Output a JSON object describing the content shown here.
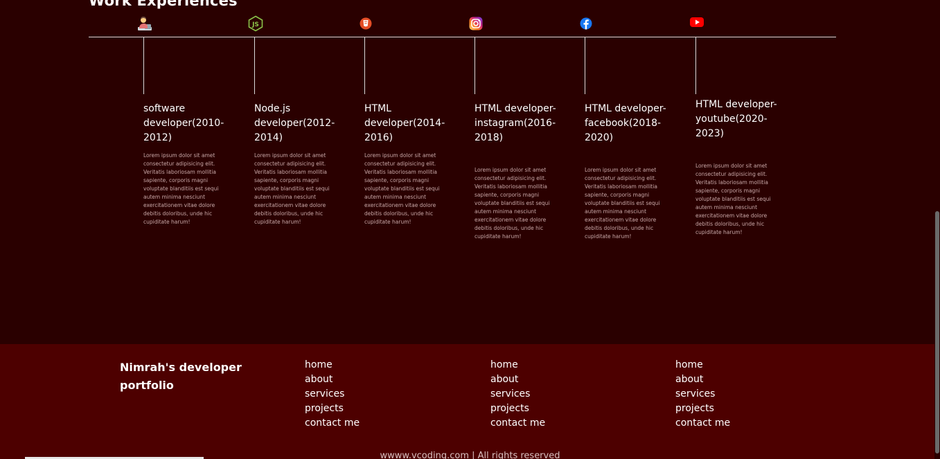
{
  "section": {
    "title": "Work Experiences"
  },
  "timeline": [
    {
      "icon": "developer-person-icon",
      "title": "software developer(2010-2012)",
      "description": "Lorem ipsum dolor sit amet consectetur adipisicing elit. Veritatis laboriosam mollitia sapiente, corporis magni voluptate blanditiis est sequi autem minima nesciunt exercitationem vitae dolore debitis doloribus, unde hic cupiditate harum!"
    },
    {
      "icon": "nodejs-icon",
      "title": "Node.js developer(2012-2014)",
      "description": "Lorem ipsum dolor sit amet consectetur adipisicing elit. Veritatis laboriosam mollitia sapiente, corporis magni voluptate blanditiis est sequi autem minima nesciunt exercitationem vitae dolore debitis doloribus, unde hic cupiditate harum!"
    },
    {
      "icon": "html5-icon",
      "title": "HTML developer(2014-2016)",
      "description": "Lorem ipsum dolor sit amet consectetur adipisicing elit. Veritatis laboriosam mollitia sapiente, corporis magni voluptate blanditiis est sequi autem minima nesciunt exercitationem vitae dolore debitis doloribus, unde hic cupiditate harum!"
    },
    {
      "icon": "instagram-icon",
      "title": "HTML developer-instagram(2016-2018)",
      "description": "Lorem ipsum dolor sit amet consectetur adipisicing elit. Veritatis laboriosam mollitia sapiente, corporis magni voluptate blanditiis est sequi autem minima nesciunt exercitationem vitae dolore debitis doloribus, unde hic cupiditate harum!"
    },
    {
      "icon": "facebook-icon",
      "title": "HTML developer-facebook(2018-2020)",
      "description": "Lorem ipsum dolor sit amet consectetur adipisicing elit. Veritatis laboriosam mollitia sapiente, corporis magni voluptate blanditiis est sequi autem minima nesciunt exercitationem vitae dolore debitis doloribus, unde hic cupiditate harum!"
    },
    {
      "icon": "youtube-icon",
      "title": "HTML developer-youtube(2020-2023)",
      "description": "Lorem ipsum dolor sit amet consectetur adipisicing elit. Veritatis laboriosam mollitia sapiente, corporis magni voluptate blanditiis est sequi autem minima nesciunt exercitationem vitae dolore debitis doloribus, unde hic cupiditate harum!"
    }
  ],
  "footer": {
    "brand": "Nimrah's developer portfolio",
    "columns": [
      {
        "links": [
          "home",
          "about",
          "services",
          "projects",
          "contact me"
        ]
      },
      {
        "links": [
          "home",
          "about",
          "services",
          "projects",
          "contact me"
        ]
      },
      {
        "links": [
          "home",
          "about",
          "services",
          "projects",
          "contact me"
        ]
      }
    ],
    "copyright": "wwww.vcoding.com | All rights reserved"
  },
  "colors": {
    "page_background": "#2a0000",
    "footer_background": "#4d0000",
    "text": "#ffffff",
    "muted_text": "#c8a8a8",
    "line": "#d9d9d9"
  }
}
